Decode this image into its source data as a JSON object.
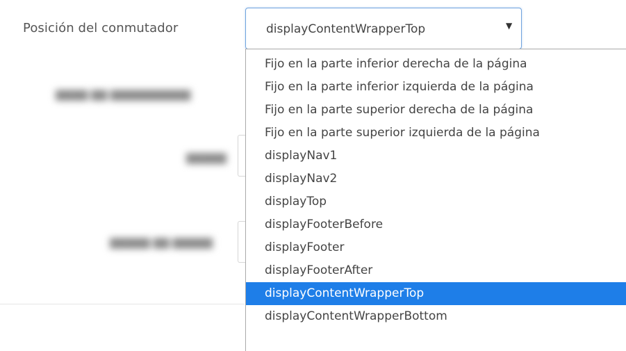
{
  "form": {
    "field_label": "Posición del conmutador",
    "select": {
      "value": "displayContentWrapperTop",
      "options": [
        "Fijo en la parte inferior derecha de la página",
        "Fijo en la parte inferior izquierda de la página",
        "Fijo en la parte superior derecha de la página",
        "Fijo en la parte superior izquierda de la página",
        "displayNav1",
        "displayNav2",
        "displayTop",
        "displayFooterBefore",
        "displayFooter",
        "displayFooterAfter",
        "displayContentWrapperTop",
        "displayContentWrapperBottom"
      ],
      "selected_index": 10,
      "arrow_icon": "triangle-down-icon"
    }
  },
  "colors": {
    "highlight": "#1e7ee8",
    "focus_border": "#6fa3de",
    "text": "#444444"
  }
}
